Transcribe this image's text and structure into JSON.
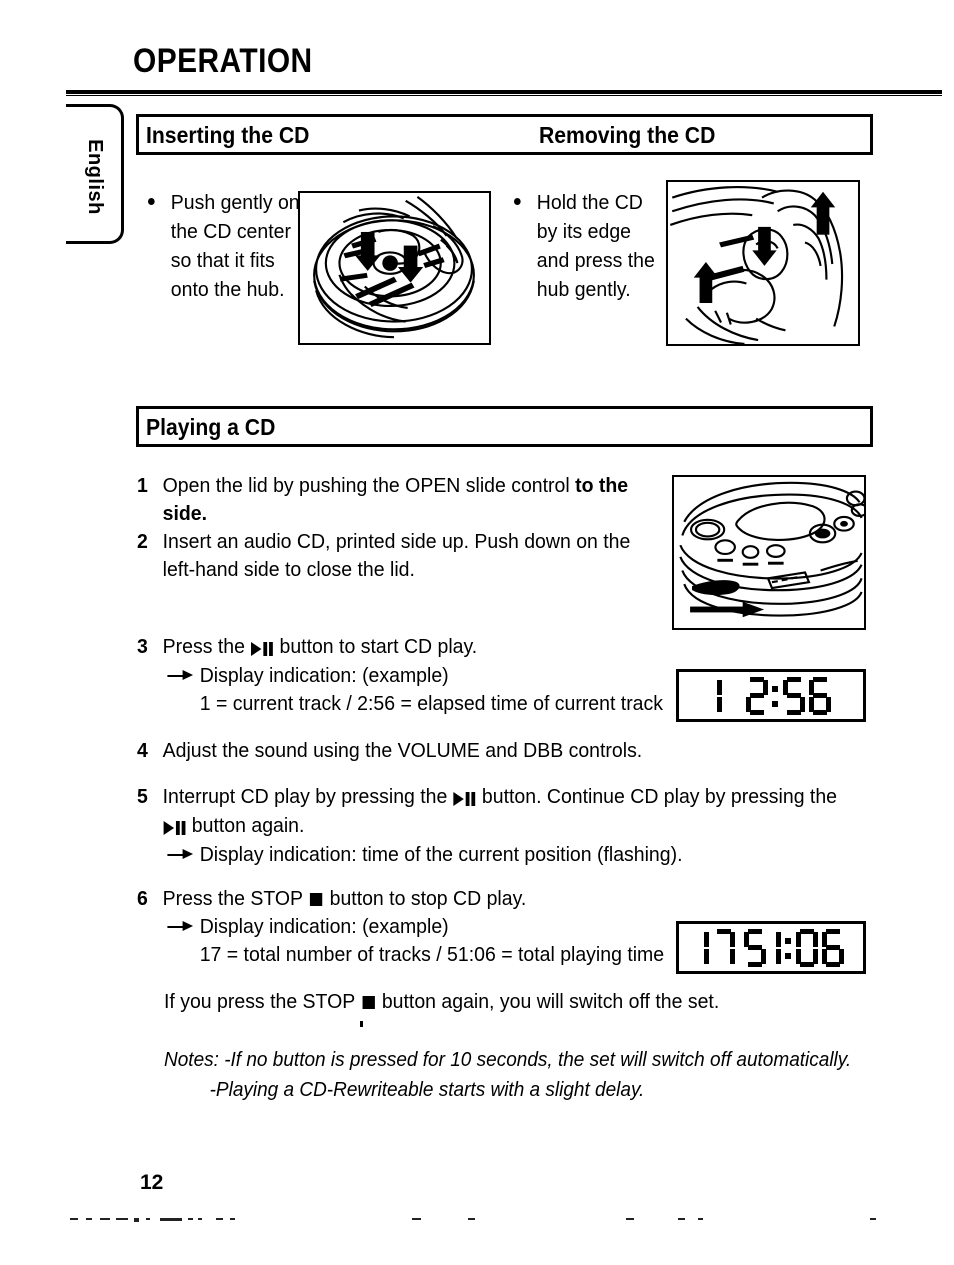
{
  "page": {
    "title": "OPERATION",
    "number": "12",
    "language_tab": "English"
  },
  "cd_handling": {
    "headers": {
      "inserting": "Inserting the CD",
      "removing": "Removing the CD"
    },
    "inserting_bullet": "Push gently on the CD center so that it fits onto the hub.",
    "removing_bullet": "Hold the CD by its edge and press the hub gently.",
    "inserting_illustration": "cd-insert-illustration",
    "removing_illustration": "cd-remove-illustration"
  },
  "playing": {
    "header": "Playing a CD",
    "steps": [
      {
        "num": "1",
        "text_plain": "Open the lid by pushing the OPEN slide control ",
        "text_bold": "to the side."
      },
      {
        "num": "2",
        "text": "Insert an audio CD, printed side up. Push down on the left-hand side to close the lid."
      },
      {
        "num": "3",
        "text_before": "Press the ",
        "text_after": " button to start CD play.",
        "sub_arrow": "Display indication: (example)",
        "detail": "1 = current track / 2:56 = elapsed time of current track"
      },
      {
        "num": "4",
        "text": "Adjust the sound using the VOLUME and DBB controls."
      },
      {
        "num": "5",
        "text_a": "Interrupt CD play by pressing the ",
        "text_b": " button. Continue CD play by pressing the ",
        "text_c": " button again.",
        "sub_arrow": "Display indication: time of the current position (flashing)."
      },
      {
        "num": "6",
        "text_before": "Press the STOP ",
        "text_after": " button to stop CD play.",
        "sub_arrow": "Display indication: (example)",
        "detail": "17 = total number of tracks / 51:06 = total playing time"
      }
    ],
    "stop_again_before": "If you press the STOP ",
    "stop_again_after": " button again, you will switch off the set.",
    "notes_label": "Notes:",
    "notes": [
      "-If no button is pressed for 10 seconds, the set will switch off automatically.",
      "-Playing a CD-Rewriteable starts with a slight delay."
    ],
    "player_illustration": "portable-cd-player-open-slide-illustration"
  },
  "displays": {
    "play_example": {
      "track": "1",
      "time": "2:56",
      "segments": [
        "1",
        " ",
        "2",
        ":",
        "5",
        "6"
      ]
    },
    "stop_example": {
      "tracks": "17",
      "time": "51:06",
      "segments": [
        "1",
        "7",
        "5",
        "1",
        ":",
        "0",
        "6"
      ]
    }
  },
  "colors": {
    "ink": "#000000",
    "paper": "#ffffff"
  }
}
